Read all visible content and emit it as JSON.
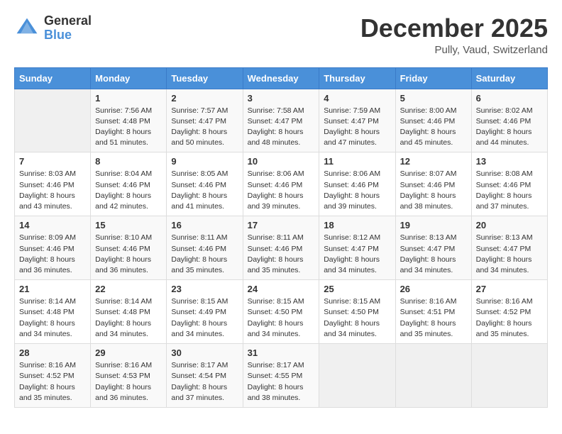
{
  "header": {
    "logo_general": "General",
    "logo_blue": "Blue",
    "month_title": "December 2025",
    "location": "Pully, Vaud, Switzerland"
  },
  "weekdays": [
    "Sunday",
    "Monday",
    "Tuesday",
    "Wednesday",
    "Thursday",
    "Friday",
    "Saturday"
  ],
  "weeks": [
    [
      {
        "day": "",
        "info": ""
      },
      {
        "day": "1",
        "info": "Sunrise: 7:56 AM\nSunset: 4:48 PM\nDaylight: 8 hours\nand 51 minutes."
      },
      {
        "day": "2",
        "info": "Sunrise: 7:57 AM\nSunset: 4:47 PM\nDaylight: 8 hours\nand 50 minutes."
      },
      {
        "day": "3",
        "info": "Sunrise: 7:58 AM\nSunset: 4:47 PM\nDaylight: 8 hours\nand 48 minutes."
      },
      {
        "day": "4",
        "info": "Sunrise: 7:59 AM\nSunset: 4:47 PM\nDaylight: 8 hours\nand 47 minutes."
      },
      {
        "day": "5",
        "info": "Sunrise: 8:00 AM\nSunset: 4:46 PM\nDaylight: 8 hours\nand 45 minutes."
      },
      {
        "day": "6",
        "info": "Sunrise: 8:02 AM\nSunset: 4:46 PM\nDaylight: 8 hours\nand 44 minutes."
      }
    ],
    [
      {
        "day": "7",
        "info": "Sunrise: 8:03 AM\nSunset: 4:46 PM\nDaylight: 8 hours\nand 43 minutes."
      },
      {
        "day": "8",
        "info": "Sunrise: 8:04 AM\nSunset: 4:46 PM\nDaylight: 8 hours\nand 42 minutes."
      },
      {
        "day": "9",
        "info": "Sunrise: 8:05 AM\nSunset: 4:46 PM\nDaylight: 8 hours\nand 41 minutes."
      },
      {
        "day": "10",
        "info": "Sunrise: 8:06 AM\nSunset: 4:46 PM\nDaylight: 8 hours\nand 39 minutes."
      },
      {
        "day": "11",
        "info": "Sunrise: 8:06 AM\nSunset: 4:46 PM\nDaylight: 8 hours\nand 39 minutes."
      },
      {
        "day": "12",
        "info": "Sunrise: 8:07 AM\nSunset: 4:46 PM\nDaylight: 8 hours\nand 38 minutes."
      },
      {
        "day": "13",
        "info": "Sunrise: 8:08 AM\nSunset: 4:46 PM\nDaylight: 8 hours\nand 37 minutes."
      }
    ],
    [
      {
        "day": "14",
        "info": "Sunrise: 8:09 AM\nSunset: 4:46 PM\nDaylight: 8 hours\nand 36 minutes."
      },
      {
        "day": "15",
        "info": "Sunrise: 8:10 AM\nSunset: 4:46 PM\nDaylight: 8 hours\nand 36 minutes."
      },
      {
        "day": "16",
        "info": "Sunrise: 8:11 AM\nSunset: 4:46 PM\nDaylight: 8 hours\nand 35 minutes."
      },
      {
        "day": "17",
        "info": "Sunrise: 8:11 AM\nSunset: 4:46 PM\nDaylight: 8 hours\nand 35 minutes."
      },
      {
        "day": "18",
        "info": "Sunrise: 8:12 AM\nSunset: 4:47 PM\nDaylight: 8 hours\nand 34 minutes."
      },
      {
        "day": "19",
        "info": "Sunrise: 8:13 AM\nSunset: 4:47 PM\nDaylight: 8 hours\nand 34 minutes."
      },
      {
        "day": "20",
        "info": "Sunrise: 8:13 AM\nSunset: 4:47 PM\nDaylight: 8 hours\nand 34 minutes."
      }
    ],
    [
      {
        "day": "21",
        "info": "Sunrise: 8:14 AM\nSunset: 4:48 PM\nDaylight: 8 hours\nand 34 minutes."
      },
      {
        "day": "22",
        "info": "Sunrise: 8:14 AM\nSunset: 4:48 PM\nDaylight: 8 hours\nand 34 minutes."
      },
      {
        "day": "23",
        "info": "Sunrise: 8:15 AM\nSunset: 4:49 PM\nDaylight: 8 hours\nand 34 minutes."
      },
      {
        "day": "24",
        "info": "Sunrise: 8:15 AM\nSunset: 4:50 PM\nDaylight: 8 hours\nand 34 minutes."
      },
      {
        "day": "25",
        "info": "Sunrise: 8:15 AM\nSunset: 4:50 PM\nDaylight: 8 hours\nand 34 minutes."
      },
      {
        "day": "26",
        "info": "Sunrise: 8:16 AM\nSunset: 4:51 PM\nDaylight: 8 hours\nand 35 minutes."
      },
      {
        "day": "27",
        "info": "Sunrise: 8:16 AM\nSunset: 4:52 PM\nDaylight: 8 hours\nand 35 minutes."
      }
    ],
    [
      {
        "day": "28",
        "info": "Sunrise: 8:16 AM\nSunset: 4:52 PM\nDaylight: 8 hours\nand 35 minutes."
      },
      {
        "day": "29",
        "info": "Sunrise: 8:16 AM\nSunset: 4:53 PM\nDaylight: 8 hours\nand 36 minutes."
      },
      {
        "day": "30",
        "info": "Sunrise: 8:17 AM\nSunset: 4:54 PM\nDaylight: 8 hours\nand 37 minutes."
      },
      {
        "day": "31",
        "info": "Sunrise: 8:17 AM\nSunset: 4:55 PM\nDaylight: 8 hours\nand 38 minutes."
      },
      {
        "day": "",
        "info": ""
      },
      {
        "day": "",
        "info": ""
      },
      {
        "day": "",
        "info": ""
      }
    ]
  ]
}
